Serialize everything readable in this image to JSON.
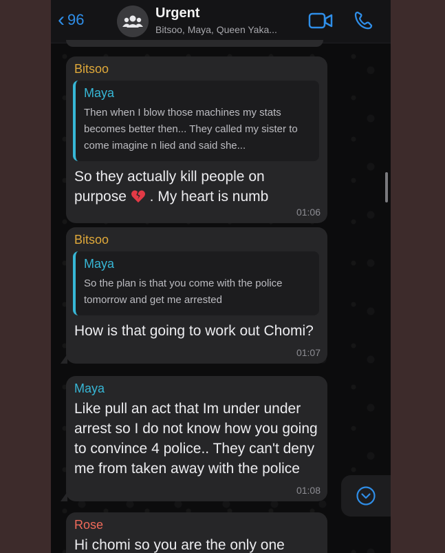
{
  "header": {
    "back_count": "96",
    "title": "Urgent",
    "subtitle": "Bitsoo, Maya, Queen Yaka..."
  },
  "icons": {
    "back": "chevron-left-icon",
    "avatar": "group-icon",
    "video": "video-call-icon",
    "call": "phone-icon",
    "scroll_down": "chevron-down-circle-icon",
    "heart": "broken-heart-icon"
  },
  "colors": {
    "accent": "#2f8ee8",
    "bitsoo": "#e0a93a",
    "maya": "#37b7d6",
    "rose": "#f06a5a",
    "bubble": "#262628"
  },
  "messages": [
    {
      "sender": "Bitsoo",
      "quote_name": "Maya",
      "quote_text": "Then when I blow those machines my stats becomes better then... They called my sister to come imagine n lied and said she...",
      "text_before": "So they actually kill people on purpose",
      "text_after": ". My heart is numb",
      "time": "01:06"
    },
    {
      "sender": "Bitsoo",
      "quote_name": "Maya",
      "quote_text": "So the plan is that you come with the police tomorrow and get me arrested",
      "text": "How is that going to work out Chomi?",
      "time": "01:07"
    },
    {
      "sender": "Maya",
      "text": "Like pull an act that Im under under arrest so I do not know how you going to convince 4 police.. They can't deny me from taken away with the police",
      "time": "01:08"
    },
    {
      "sender": "Rose",
      "text": "Hi chomi so you are the only one"
    }
  ]
}
